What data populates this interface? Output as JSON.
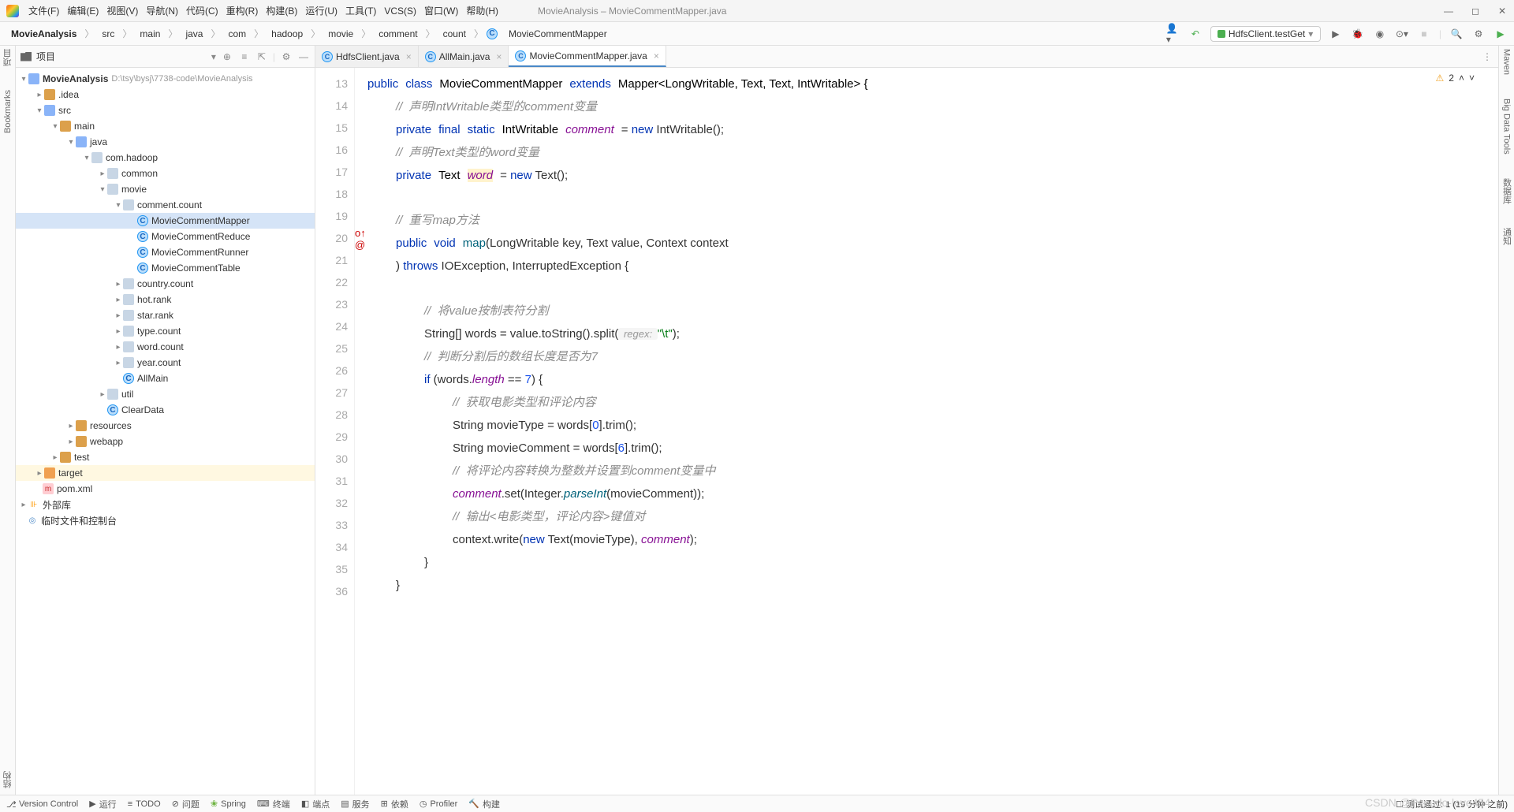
{
  "window": {
    "title": "MovieAnalysis – MovieCommentMapper.java"
  },
  "menu": {
    "file": "文件(F)",
    "edit": "编辑(E)",
    "view": "视图(V)",
    "nav": "导航(N)",
    "code": "代码(C)",
    "refactor": "重构(R)",
    "build": "构建(B)",
    "run": "运行(U)",
    "tools": "工具(T)",
    "vcs": "VCS(S)",
    "window": "窗口(W)",
    "help": "帮助(H)"
  },
  "crumbs": [
    "MovieAnalysis",
    "src",
    "main",
    "java",
    "com",
    "hadoop",
    "movie",
    "comment",
    "count",
    "MovieCommentMapper"
  ],
  "run_config": "HdfsClient.testGet",
  "project": {
    "panel_title": "项目",
    "root": "MovieAnalysis",
    "root_path": "D:\\tsy\\bysj\\7738-code\\MovieAnalysis",
    "idea": ".idea",
    "src": "src",
    "main": "main",
    "java": "java",
    "pkg": "com.hadoop",
    "common": "common",
    "movie": "movie",
    "comment_count": "comment.count",
    "files": {
      "mapper": "MovieCommentMapper",
      "reduce": "MovieCommentReduce",
      "runner": "MovieCommentRunner",
      "table": "MovieCommentTable"
    },
    "country": "country.count",
    "hotrank": "hot.rank",
    "starrank": "star.rank",
    "typecount": "type.count",
    "wordcount": "word.count",
    "yearcount": "year.count",
    "allmain": "AllMain",
    "util": "util",
    "cleardata": "ClearData",
    "resources": "resources",
    "webapp": "webapp",
    "test": "test",
    "target": "target",
    "pom": "pom.xml",
    "extlib": "外部库",
    "scratch": "临时文件和控制台"
  },
  "tabs": {
    "t1": "HdfsClient.java",
    "t2": "AllMain.java",
    "t3": "MovieCommentMapper.java"
  },
  "warnings": {
    "count": "2"
  },
  "code": {
    "lines": [
      "13",
      "14",
      "15",
      "16",
      "17",
      "18",
      "19",
      "20",
      "21",
      "22",
      "23",
      "24",
      "25",
      "26",
      "27",
      "28",
      "29",
      "30",
      "31",
      "32",
      "33",
      "34",
      "35",
      "36"
    ],
    "sig_public": "public",
    "sig_class": "class",
    "class_name": "MovieCommentMapper",
    "sig_extends": "extends",
    "mapper_generic": "Mapper<LongWritable, Text, Text, IntWritable> {",
    "c14": "//  声明IntWritable类型的comment变量",
    "private": "private",
    "final": "final",
    "static": "static",
    "intwritable": "IntWritable",
    "comment": "comment",
    "eqnew": "= ",
    "new": "new",
    "intwritable_ctor": " IntWritable();",
    "c16": "//  声明Text类型的word变量",
    "text": "Text",
    "word": "word",
    "text_ctor": " Text();",
    "c19": "//  重写map方法",
    "void": "void",
    "map": "map",
    "map_params": "(LongWritable key, Text value, Context context",
    "paren": ") ",
    "throws": "throws",
    "throws_types": " IOException, InterruptedException {",
    "c23": "//  将value按制表符分割",
    "l24a": "String[] words = value.toString().split(",
    "regex_hint": " regex: ",
    "l24b": "\"\\t\"",
    "l24c": ");",
    "c25": "//  判断分割后的数组长度是否为7",
    "if": "if",
    "l26a": " (words.",
    "length": "length",
    "l26b": " == ",
    "seven": "7",
    "l26c": ") {",
    "c27": "//  获取电影类型和评论内容",
    "l28a": "String movieType = words[",
    "zero": "0",
    "l28b": "].trim();",
    "l29a": "String movieComment = words[",
    "six": "6",
    "l29b": "].trim();",
    "c30": "//  将评论内容转换为整数并设置到comment变量中",
    "l31a": ".set(Integer.",
    "parseInt": "parseInt",
    "l31b": "(movieComment));",
    "c32": "//  输出<电影类型，评论内容>键值对",
    "l33a": "context.write(",
    "l33b": " Text(movieType), ",
    "l33c": ");",
    "rbrace": "}",
    "rbrace2": "}"
  },
  "leftbar": {
    "project": "项目",
    "bookmarks": "Bookmarks",
    "struct": "结构"
  },
  "rightbar": {
    "maven": "Maven",
    "bigdata": "Big Data Tools",
    "database": "数据库",
    "notif": "通知"
  },
  "bottom": {
    "vcs": "Version Control",
    "run": "运行",
    "todo": "TODO",
    "problems": "问题",
    "spring": "Spring",
    "terminal": "终端",
    "endpoints": "端点",
    "services": "服务",
    "deps": "依赖",
    "profiler": "Profiler",
    "build": "构建"
  },
  "status": "测试通过: 1 (19 分钟 之前)",
  "watermark": "CSDN @Pseudo-love454"
}
